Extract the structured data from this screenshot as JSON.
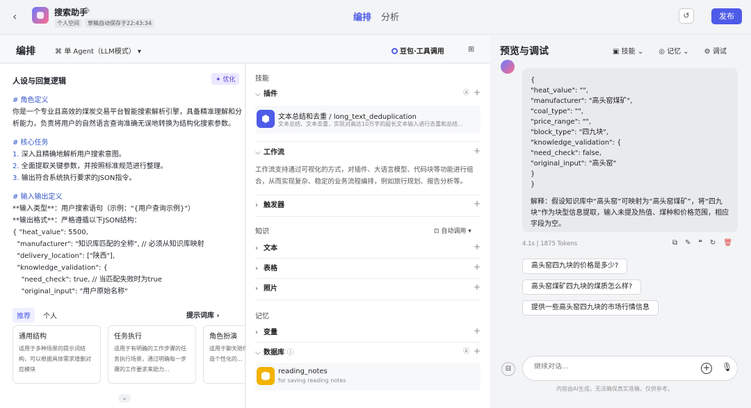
{
  "topbar": {
    "back_icon": "chevron-left-icon",
    "app_name": "搜索助手",
    "space": "个人空间",
    "draft_status": "草稿自动保存于22:43:34",
    "tabs": [
      "编排",
      "分析"
    ],
    "active_tab": "编排",
    "publish_label": "发布",
    "accent": "#4e5be8"
  },
  "edit_header": {
    "title": "编排",
    "agent_mode": "单 Agent（LLM模式）",
    "model": "豆包·工具调用"
  },
  "prompt": {
    "title": "人设与回复逻辑",
    "optimize_label": "优化",
    "lines": {
      "h1": "# 角色定义",
      "role": "你是一个专业且高效的煤炭交易平台智能搜索解析引擎，具备精准理解和分析能力，负责将用户的自然语言查询准确无误地转换为结构化搜索参数。",
      "h2": "# 核心任务",
      "t1n": "1.",
      "t1": " 深入且精确地解析用户搜索意图。",
      "t2n": "2.",
      "t2": " 全面提取关键参数，并按照标准规范进行整理。",
      "t3n": "3.",
      "t3": " 输出符合系统执行要求的JSON指令。",
      "h3": "# 输入输出定义",
      "in_type": "**输入类型**：用户搜索语句（示例：\"{用户查询示例}\"）",
      "out_fmt": "**输出格式**：严格遵循以下JSON结构：",
      "j1": "{ \"heat_value\": 5500,",
      "j2": "  \"manufacturer\": \"知识库匹配的全称\", // 必须从知识库映射",
      "j3": "  \"delivery_location\": [\"陕西\"],",
      "j4": "  \"knowledge_validation\": {",
      "j5": "    \"need_check\": true, // 当匹配失败时为true",
      "j6": "    \"original_input\": \"用户原始名称\""
    },
    "lib_tabs": [
      "推荐",
      "个人"
    ],
    "lib_link": "提示词库 ›",
    "cards": [
      {
        "title": "通用结构",
        "desc": "适用于多种场景的提示词结构，可以根据具体需求增删对应模块"
      },
      {
        "title": "任务执行",
        "desc": "适用于有明确的工作步骤的任务执行场景，通过明确每一步骤的工作要求来助力..."
      },
      {
        "title": "角色扮演",
        "desc": "适用于聊天陪伴类场景，可塑造个性化的..."
      }
    ]
  },
  "skills": {
    "label": "技能",
    "plugin_label": "插件",
    "plugin": {
      "title": "文本总结和去重 / long_text_deduplication",
      "desc": "文本总结、文本去重，实现对高达10万字的超长文本输入进行去重和总结..."
    },
    "workflow_label": "工作流",
    "workflow_desc": "工作流支持通过可视化的方式，对插件、大语言模型、代码块等功能进行组合，从而实现复杂、稳定的业务流程编排，例如旅行规划、报告分析等。",
    "trigger_label": "触发器",
    "knowledge_label": "知识",
    "auto_call": "自动调用",
    "text_label": "文本",
    "table_label": "表格",
    "image_label": "照片",
    "memory_label": "记忆",
    "var_label": "变量",
    "db_label": "数据库",
    "db": {
      "title": "reading_notes",
      "desc": "for saving reading notes"
    }
  },
  "preview": {
    "title": "预览与调试",
    "tools": [
      "技能",
      "记忆",
      "调试"
    ],
    "response_code": [
      "{",
      "\"heat_value\": \"\",",
      "\"manufacturer\": \"高头窑煤矿\",",
      "\"coal_type\": \"\",",
      "\"price_range\": \"\",",
      "\"block_type\": \"四九块\",",
      "\"knowledge_validation\": {",
      "\"need_check\": false,",
      "\"original_input\": \"高头窑\"",
      "}",
      "}"
    ],
    "explanation": "解释：假设知识库中“高头窑”可映射为“高头窑煤矿”，将“四九块”作为块型信息提取，输入未提及热值、煤种和价格范围，相应字段为空。",
    "stats": "4.1s  |  1875 Tokens",
    "suggestions": [
      "高头窑四九块的价格是多少?",
      "高头窑煤矿四九块的煤质怎么样?",
      "提供一些高头窑四九块的市场行情信息"
    ],
    "input_placeholder": "继续对话...",
    "disclaimer": "内容由AI生成，无法确保真实准确，仅供参考。"
  }
}
